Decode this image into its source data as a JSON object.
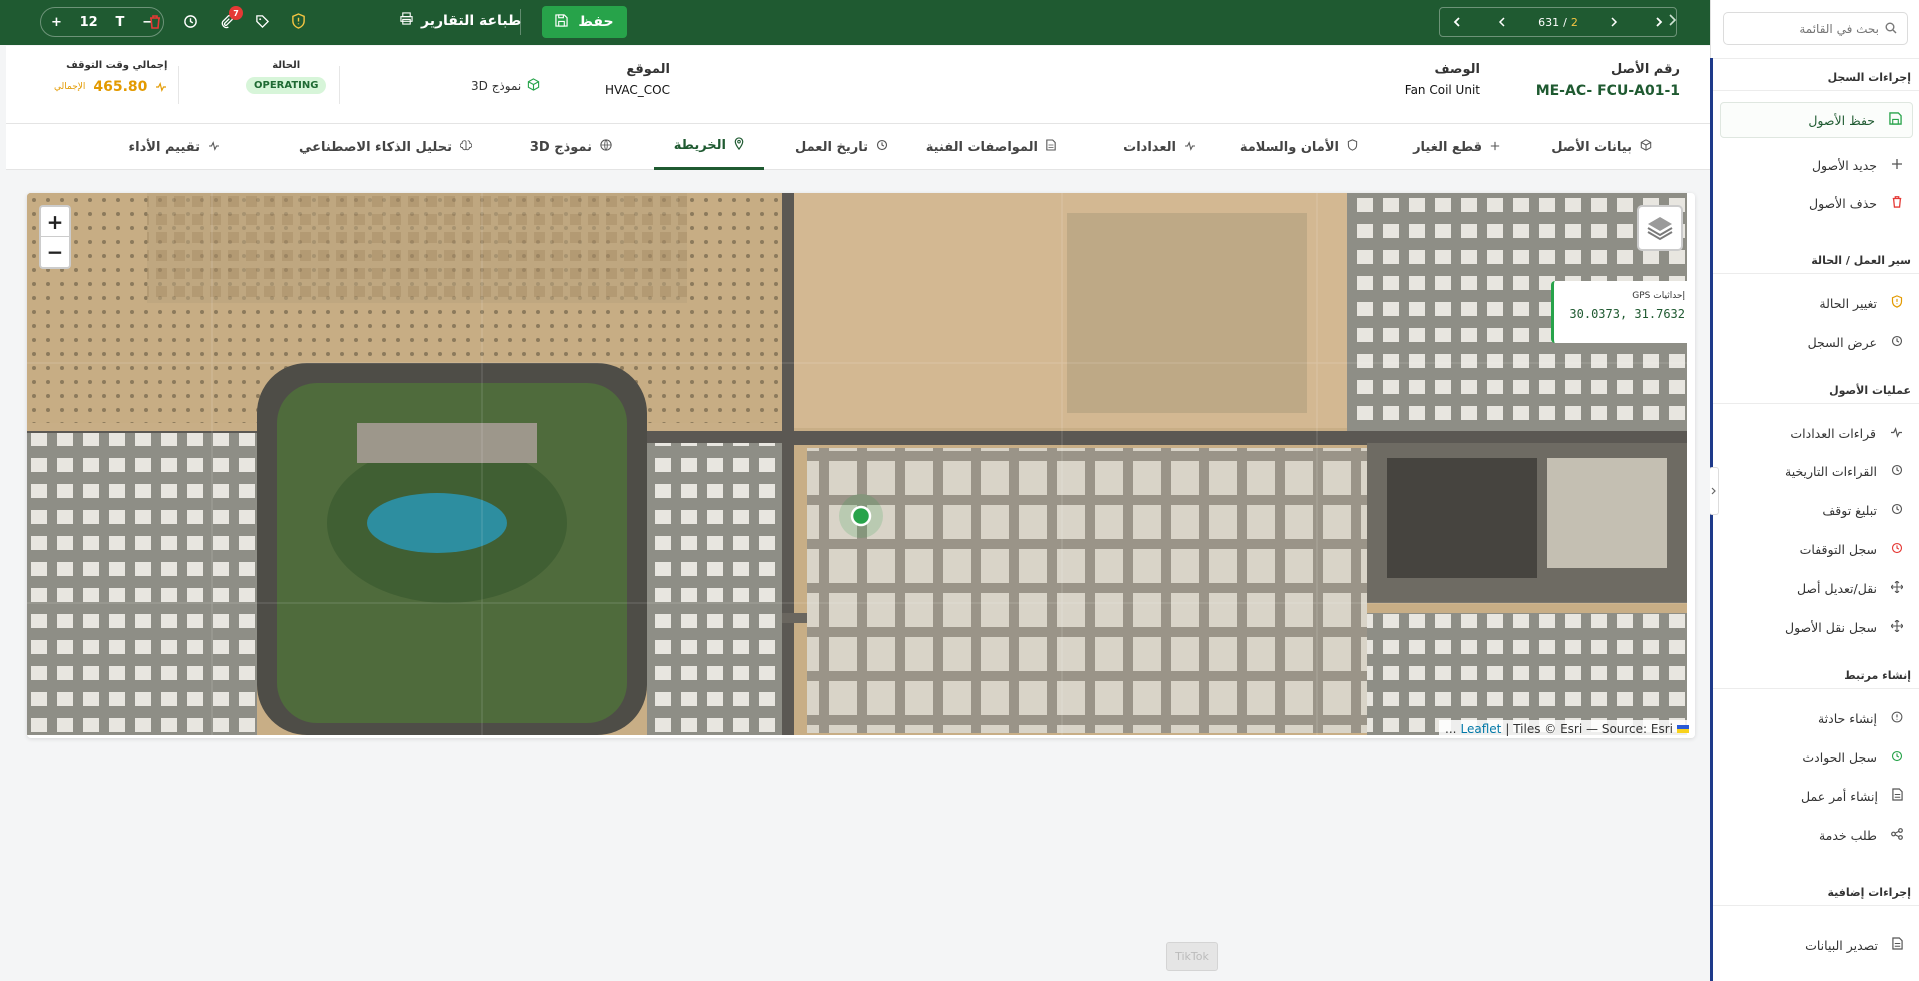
{
  "toolbar": {
    "font_size_value": "12",
    "font_icon": "T",
    "notification_count": "7",
    "print_label": "طباعة التقارير",
    "save_label": "حفظ",
    "pager_current": "2",
    "pager_separator": "/",
    "pager_total": "631"
  },
  "sidebar": {
    "search_placeholder": "بحث في القائمة",
    "sections": {
      "record_actions": "إجراءات السجل",
      "workflow": "سير العمل / الحالة",
      "asset_ops": "عمليات الأصول",
      "create_related": "إنشاء مرتبط",
      "extra_actions": "إجراءات إضافية"
    },
    "items": {
      "save_assets": "حفظ الأصول",
      "new_asset": "جديد الأصول",
      "delete_assets": "حذف الأصول",
      "change_status": "تغيير الحالة",
      "view_log": "عرض السجل",
      "meter_readings": "قراءات العدادات",
      "historical_readings": "القراءات التاريخية",
      "report_downtime": "تبليغ توقف",
      "downtime_log": "سجل التوقفات",
      "move_modify_asset": "نقل/تعديل أصل",
      "asset_move_log": "سجل نقل الأصول",
      "create_incident": "إنشاء حادثة",
      "incident_log": "سجل الحوادث",
      "create_work_order": "إنشاء أمر عمل",
      "service_request": "طلب خدمة",
      "export_data": "تصدير البيانات"
    }
  },
  "header": {
    "asset_number_label": "رقم الأصل",
    "asset_number_value": "ME-AC- FCU-A01-1",
    "description_label": "الوصف",
    "description_value": "Fan Coil Unit",
    "location_label": "الموقع",
    "location_value": "HVAC_COC",
    "model3d_label": "نموذج 3D",
    "status_label": "الحالة",
    "status_value": "OPERATING",
    "downtime_label": "إجمالي وقت التوقف",
    "downtime_value": "465.80",
    "downtime_tag": "الإجمالي"
  },
  "tabs": [
    {
      "label": "بيانات الأصل",
      "icon": "cube-icon"
    },
    {
      "label": "قطع الغيار",
      "icon": "plus-icon"
    },
    {
      "label": "الأمان والسلامة",
      "icon": "shield-icon"
    },
    {
      "label": "العدادات",
      "icon": "activity-icon"
    },
    {
      "label": "المواصفات الفنية",
      "icon": "document-icon"
    },
    {
      "label": "تاريخ العمل",
      "icon": "history-icon"
    },
    {
      "label": "الخريطة",
      "icon": "map-pin-icon"
    },
    {
      "label": "نموذج 3D",
      "icon": "globe-icon"
    },
    {
      "label": "تحليل الذكاء الاصطناعي",
      "icon": "brain-icon"
    },
    {
      "label": "تقييم الأداء",
      "icon": "activity-icon"
    }
  ],
  "active_tab": "الخريطة",
  "map": {
    "zoom_in": "+",
    "zoom_out": "−",
    "gps_title": "إحداثيات GPS",
    "gps_value": "30.0373, 31.7632",
    "attribution_link": "Leaflet",
    "attribution_text": "| Tiles © Esri — Source: Esri",
    "attribution_ellipsis": "..."
  },
  "watermark": "TikTok",
  "colors": {
    "brand_green": "#1f5a31",
    "accent_green": "#27a34a",
    "warning_orange": "#e39a00",
    "danger_red": "#e53935",
    "sidebar_accent": "#1e3a8a"
  }
}
